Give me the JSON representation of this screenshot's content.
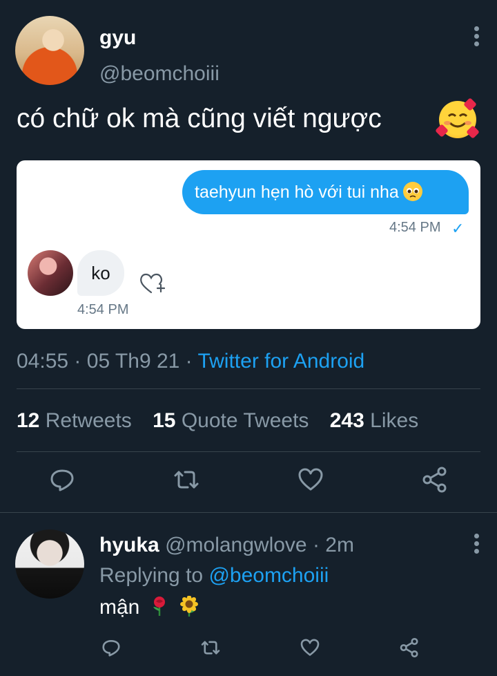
{
  "tweet": {
    "author_name": "gyu",
    "author_handle": "@beomchoiii",
    "text": "có chữ ok mà cũng viết ngược",
    "emoji": "smiling-face-with-hearts"
  },
  "media": {
    "outgoing_message": "taehyun hẹn hò với tui nha",
    "outgoing_emoji": "pleading-face",
    "outgoing_time": "4:54 PM",
    "incoming_message": "ko",
    "incoming_time": "4:54 PM"
  },
  "meta": {
    "time": "04:55",
    "date": "05 Th9 21",
    "sep": "·",
    "source": "Twitter for Android"
  },
  "stats": {
    "retweets_count": "12",
    "retweets_label": "Retweets",
    "quotes_count": "15",
    "quotes_label": "Quote Tweets",
    "likes_count": "243",
    "likes_label": "Likes"
  },
  "reply": {
    "author_name": "hyuka",
    "author_handle": "@molangwlove",
    "time": "2m",
    "sep": "·",
    "replying_label": "Replying to",
    "replying_handle": "@beomchoiii",
    "text": "mận",
    "emojis": [
      "rose",
      "sunflower"
    ]
  },
  "colors": {
    "background": "#15202b",
    "accent": "#1da1f2",
    "muted": "#8899a6",
    "divider": "#38444d"
  }
}
